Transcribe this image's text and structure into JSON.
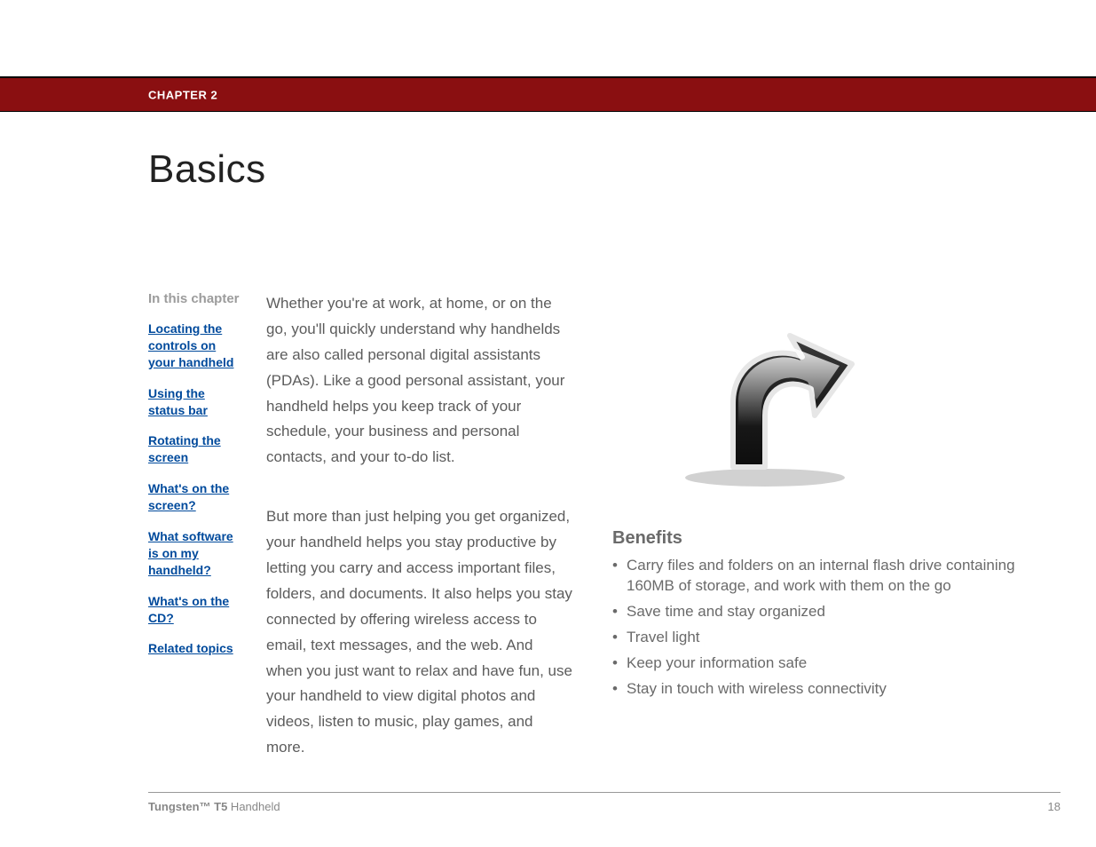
{
  "header": {
    "chapter_label": "CHAPTER 2"
  },
  "title": "Basics",
  "sidebar": {
    "heading": "In this chapter",
    "links": [
      "Locating the controls on your handheld",
      "Using the status bar",
      "Rotating the screen",
      "What's on the screen?",
      "What software is on my handheld?",
      "What's on the CD?",
      "Related topics"
    ]
  },
  "body": {
    "p1": "Whether you're at work, at home, or on the go, you'll quickly understand why handhelds are also called personal digital assistants (PDAs). Like a good personal assistant, your handheld helps you keep track of your schedule, your business and personal contacts, and your to-do list.",
    "p2": "But more than just helping you get organized, your handheld helps you stay productive by letting you carry and access important files, folders, and documents. It also helps you stay connected by offering wireless access to email, text messages, and the web. And when you just want to relax and have fun, use your handheld to view digital photos and videos, listen to music, play games, and more."
  },
  "benefits": {
    "heading": "Benefits",
    "items": [
      "Carry files and folders on an internal flash drive containing 160MB of storage, and work with them on the go",
      "Save time and stay organized",
      "Travel light",
      "Keep your information safe",
      "Stay in touch with wireless connectivity"
    ]
  },
  "footer": {
    "product_bold": "Tungsten™ T5",
    "product_light": " Handheld",
    "page": "18"
  }
}
